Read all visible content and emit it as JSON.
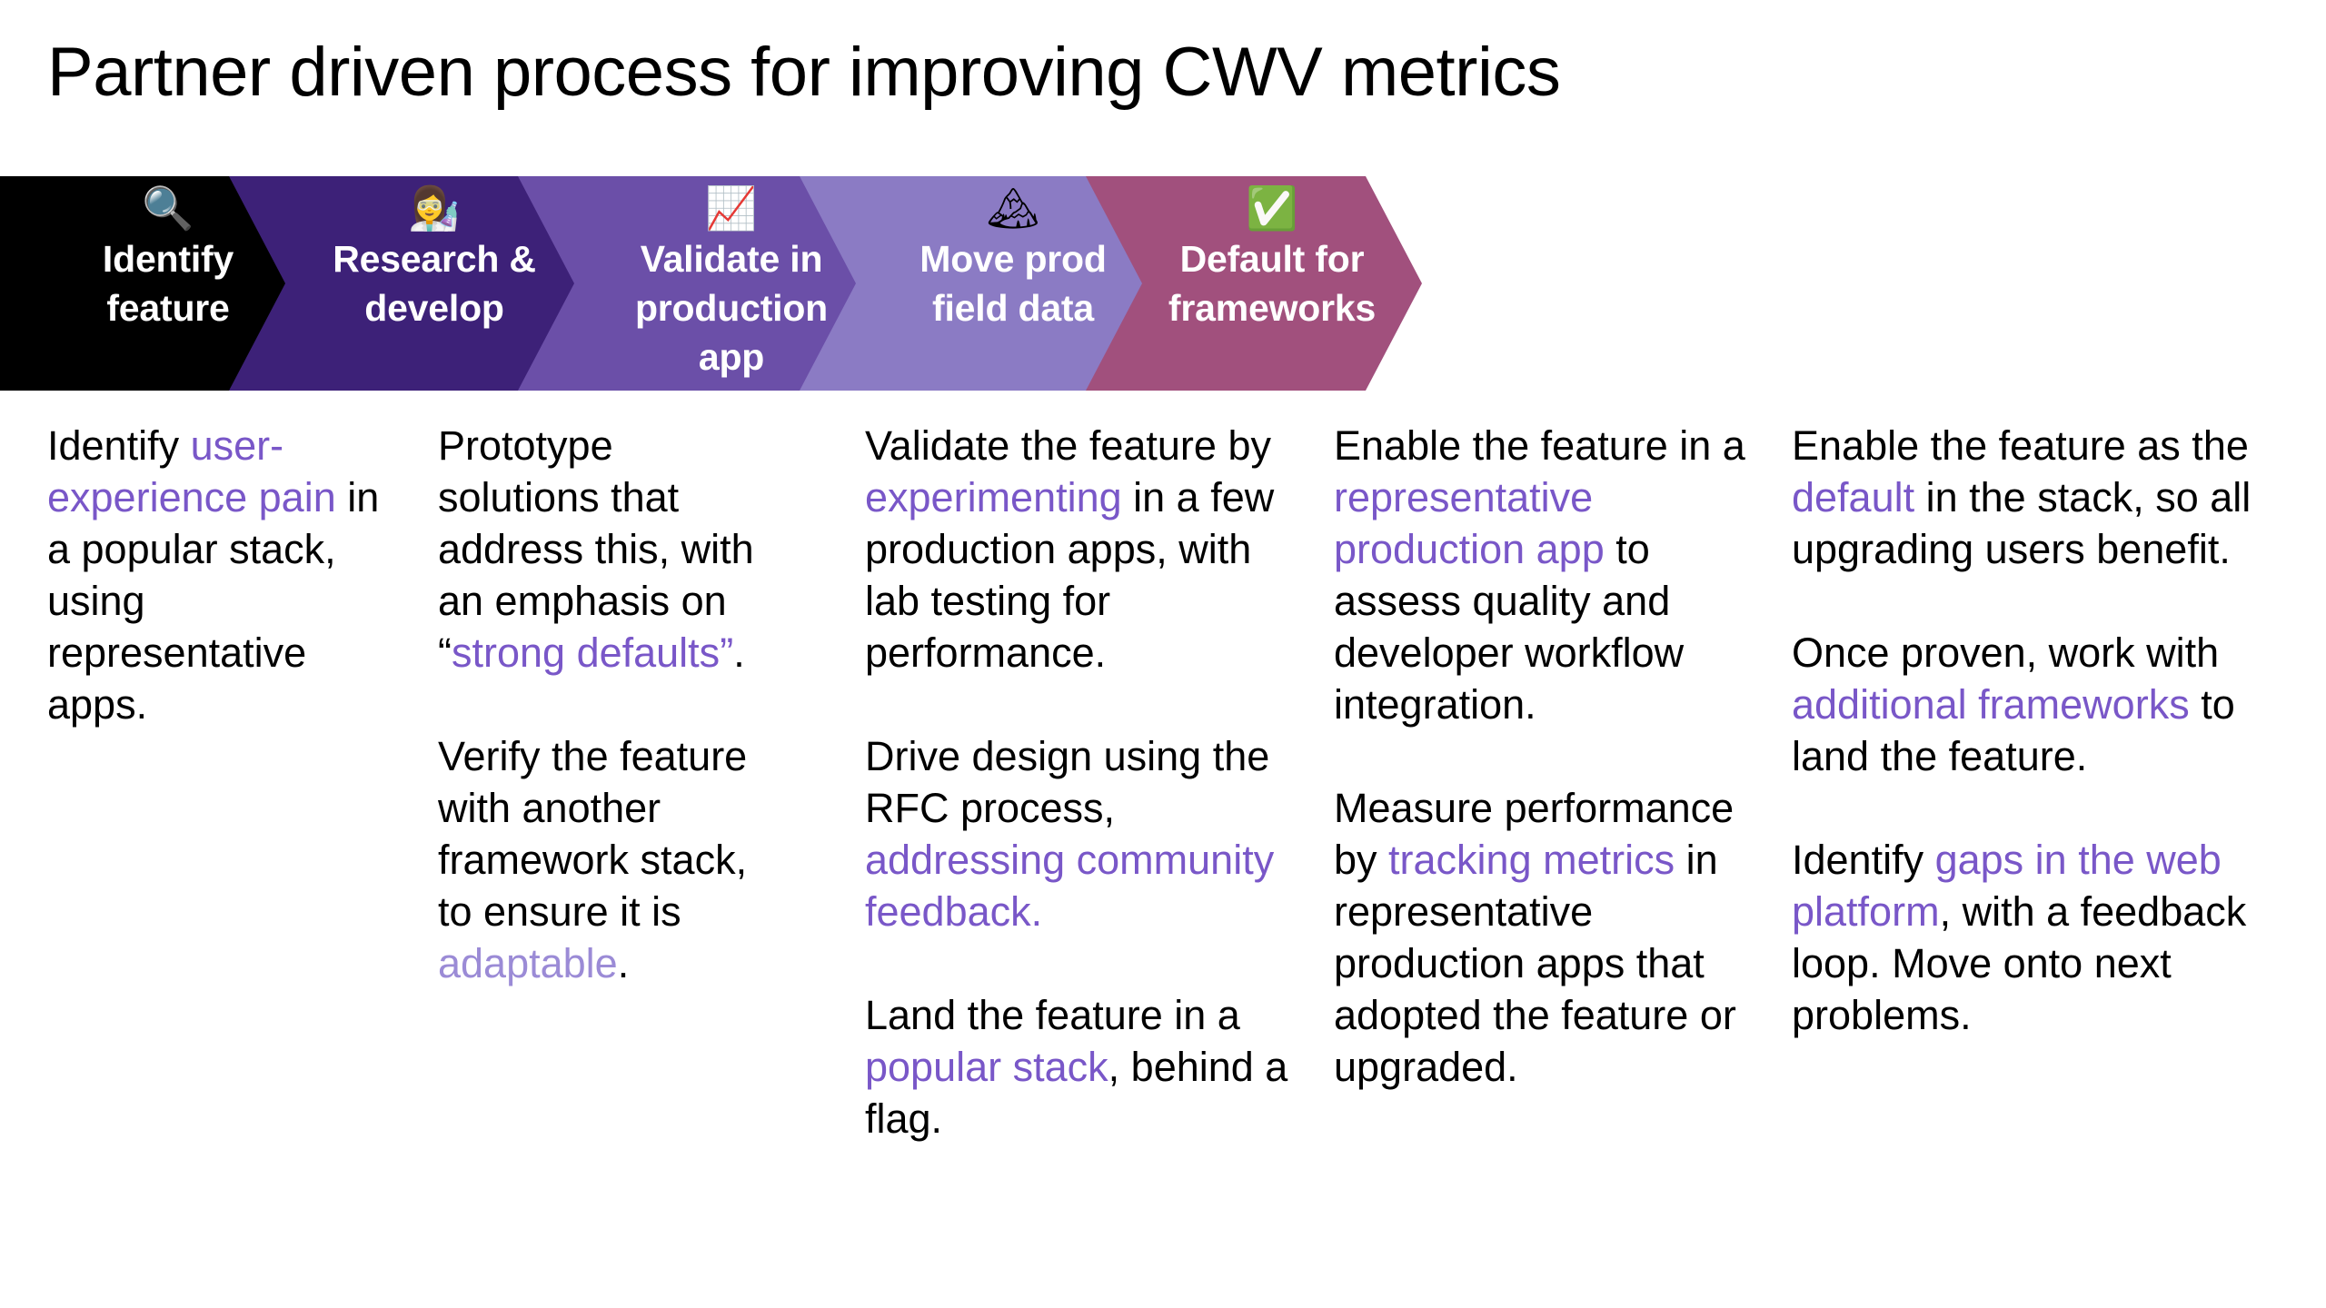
{
  "slide": {
    "title": "Partner driven process for improving CWV metrics",
    "background_color": "#ffffff",
    "accent_color": "#7957c8",
    "accent_light_color": "#9b8bd6"
  },
  "stages": [
    {
      "id": "identify-feature",
      "icon": "magnifying-glass-icon",
      "icon_glyph": "🔍",
      "label_line1": "Identify",
      "label_line2": "feature",
      "color": "#000000"
    },
    {
      "id": "research-develop",
      "icon": "scientist-icon",
      "icon_glyph": "👩‍🔬",
      "label_line1": "Research &",
      "label_line2": "develop",
      "color": "#3d2178"
    },
    {
      "id": "validate-in-production-app",
      "icon": "chart-increasing-icon",
      "icon_glyph": "📈",
      "label_line1": "Validate in",
      "label_line2": "production",
      "label_line3": "app",
      "color": "#6b4fa8"
    },
    {
      "id": "move-prod-field-data",
      "icon": "snow-capped-mountain-icon",
      "icon_glyph": "🏔",
      "label_line1": "Move prod",
      "label_line2": "field data",
      "color": "#8b7bc4"
    },
    {
      "id": "default-for-frameworks",
      "icon": "check-mark-button-icon",
      "icon_glyph": "✅",
      "label_line1": "Default for",
      "label_line2": "frameworks",
      "color": "#a1507d"
    }
  ],
  "columns": [
    {
      "id": "identify-feature-body",
      "paragraphs": [
        [
          {
            "text": "Identify ",
            "style": "plain"
          },
          {
            "text": "user-experience pain",
            "style": "accent"
          },
          {
            "text": " in a popular stack, using representative apps.",
            "style": "plain"
          }
        ]
      ]
    },
    {
      "id": "research-develop-body",
      "paragraphs": [
        [
          {
            "text": "Prototype solutions that address this, with an emphasis on “",
            "style": "plain"
          },
          {
            "text": "strong defaults",
            "style": "accent"
          },
          {
            "text": "”",
            "style": "accent"
          },
          {
            "text": ".",
            "style": "plain"
          }
        ],
        [
          {
            "text": "Verify the feature with another framework stack, to ensure it is ",
            "style": "plain"
          },
          {
            "text": "adaptable",
            "style": "accent-light"
          },
          {
            "text": ".",
            "style": "plain"
          }
        ]
      ]
    },
    {
      "id": "validate-in-production-app-body",
      "paragraphs": [
        [
          {
            "text": "Validate the feature by ",
            "style": "plain"
          },
          {
            "text": "experimenting",
            "style": "accent"
          },
          {
            "text": " in a few production apps, with lab testing for performance.",
            "style": "plain"
          }
        ],
        [
          {
            "text": "Drive design using the RFC process, ",
            "style": "plain"
          },
          {
            "text": "addressing community feedback.",
            "style": "accent"
          }
        ],
        [
          {
            "text": "Land the feature in a ",
            "style": "plain"
          },
          {
            "text": "popular stack",
            "style": "accent"
          },
          {
            "text": ", behind a flag.",
            "style": "plain"
          }
        ]
      ]
    },
    {
      "id": "move-prod-field-data-body",
      "paragraphs": [
        [
          {
            "text": "Enable the feature in a ",
            "style": "plain"
          },
          {
            "text": "representative production app",
            "style": "accent"
          },
          {
            "text": " to assess quality and developer workflow integration.",
            "style": "plain"
          }
        ],
        [
          {
            "text": "Measure performance by ",
            "style": "plain"
          },
          {
            "text": "tracking metrics",
            "style": "accent"
          },
          {
            "text": " in representative production apps that adopted the feature or upgraded.",
            "style": "plain"
          }
        ]
      ]
    },
    {
      "id": "default-for-frameworks-body",
      "paragraphs": [
        [
          {
            "text": "Enable the feature as the ",
            "style": "plain"
          },
          {
            "text": "default",
            "style": "accent"
          },
          {
            "text": " in the stack, so all upgrading users benefit.",
            "style": "plain"
          }
        ],
        [
          {
            "text": "Once proven, work with ",
            "style": "plain"
          },
          {
            "text": "additional frameworks",
            "style": "accent"
          },
          {
            "text": " to land the feature.",
            "style": "plain"
          }
        ],
        [
          {
            "text": "Identify ",
            "style": "plain"
          },
          {
            "text": "gaps in the web platform",
            "style": "accent"
          },
          {
            "text": ", with a feedback loop. Move onto next problems.",
            "style": "plain"
          }
        ]
      ]
    }
  ]
}
